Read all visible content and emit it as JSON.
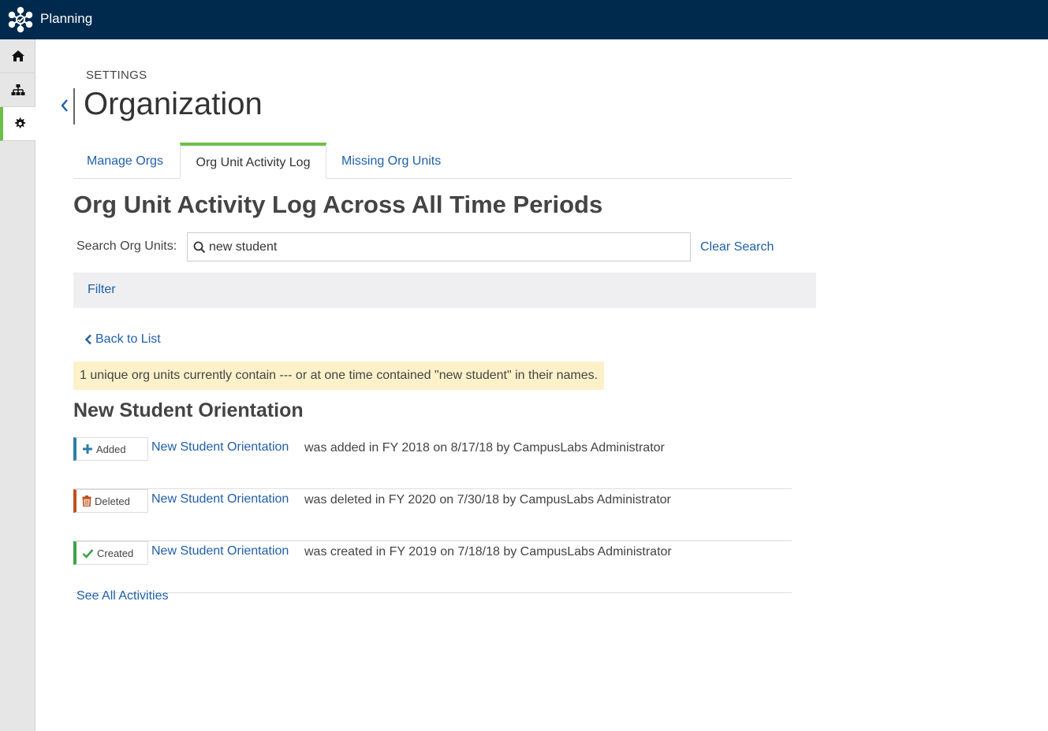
{
  "app": {
    "title": "Planning",
    "logo_icon": "network-logo-icon"
  },
  "sidebar": {
    "items": [
      {
        "name": "home",
        "icon": "home-icon"
      },
      {
        "name": "org-chart",
        "icon": "org-chart-icon"
      },
      {
        "name": "settings",
        "icon": "gear-icon",
        "active": true
      }
    ]
  },
  "header": {
    "eyebrow": "SETTINGS",
    "title": "Organization"
  },
  "tabs": [
    {
      "label": "Manage Orgs"
    },
    {
      "label": "Org Unit Activity Log",
      "active": true
    },
    {
      "label": "Missing Org Units"
    }
  ],
  "section": {
    "title": "Org Unit Activity Log Across All Time Periods"
  },
  "search": {
    "label": "Search Org Units:",
    "value": "new student",
    "clear_label": "Clear Search"
  },
  "filter": {
    "label": "Filter"
  },
  "back": {
    "label": "Back to List"
  },
  "notice": {
    "text": "1 unique org units currently contain --- or at one time contained \"new student\" in their names."
  },
  "group": {
    "title": "New Student Orientation"
  },
  "activities": [
    {
      "type": "Added",
      "icon": "plus-icon",
      "color": "#2b7fa8",
      "link": "New Student Orientation",
      "description": "was added in FY 2018 on 8/17/18 by CampusLabs Administrator"
    },
    {
      "type": "Deleted",
      "icon": "trash-icon",
      "color": "#c0501b",
      "link": "New Student Orientation",
      "description": "was deleted in FY 2020 on 7/30/18 by CampusLabs Administrator"
    },
    {
      "type": "Created",
      "icon": "check-icon",
      "color": "#3aa34a",
      "link": "New Student Orientation",
      "description": "was created in FY 2019 on 7/18/18 by CampusLabs Administrator"
    }
  ],
  "footer": {
    "see_all_label": "See All Activities"
  }
}
